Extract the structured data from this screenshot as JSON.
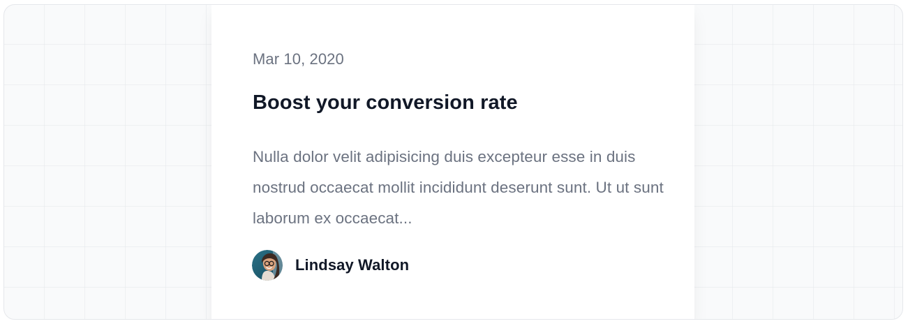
{
  "post": {
    "date": "Mar 10, 2020",
    "title": "Boost your conversion rate",
    "excerpt": "Nulla dolor velit adipisicing duis excepteur esse in duis nostrud occaecat mollit incididunt deserunt sunt. Ut ut sunt laborum ex occaecat...",
    "author": {
      "name": "Lindsay Walton",
      "avatar_icon": "user-avatar-photo"
    }
  },
  "colors": {
    "title": "#111827",
    "muted_text": "#6b7280",
    "card_background": "#ffffff",
    "canvas_background": "#f9fafb",
    "grid_line": "#e5e7eb"
  }
}
